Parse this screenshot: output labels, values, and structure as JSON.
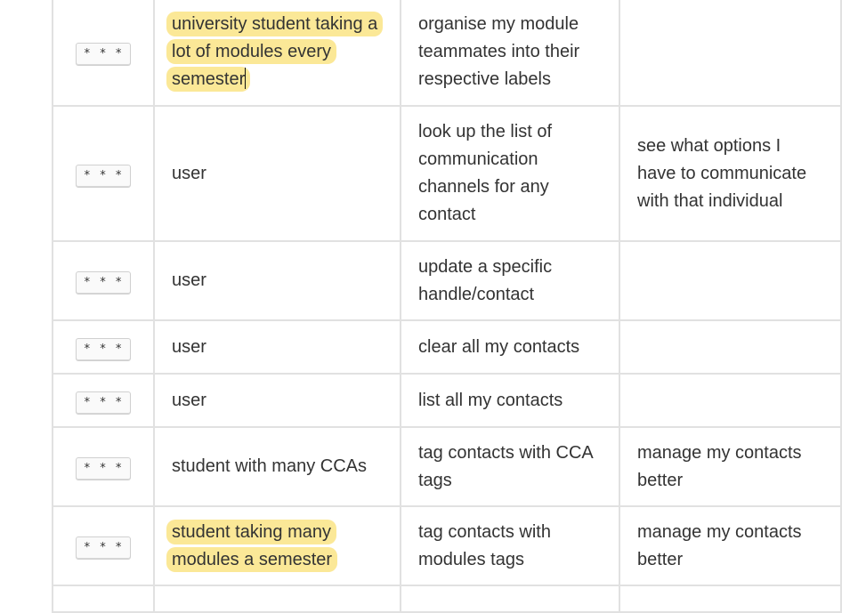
{
  "rows": [
    {
      "priority": "* * *",
      "as_a": "university student taking a lot of modules every semester",
      "as_a_highlighted": true,
      "i_want_to": "organise my module teammates into their respective labels",
      "so_that": ""
    },
    {
      "priority": "* * *",
      "as_a": "user",
      "as_a_highlighted": false,
      "i_want_to": "look up the list of communication channels for any contact",
      "so_that": "see what options I have to communicate with that individual"
    },
    {
      "priority": "* * *",
      "as_a": "user",
      "as_a_highlighted": false,
      "i_want_to": "update a specific handle/contact",
      "so_that": ""
    },
    {
      "priority": "* * *",
      "as_a": "user",
      "as_a_highlighted": false,
      "i_want_to": "clear all my contacts",
      "so_that": ""
    },
    {
      "priority": "* * *",
      "as_a": "user",
      "as_a_highlighted": false,
      "i_want_to": "list all my contacts",
      "so_that": ""
    },
    {
      "priority": "* * *",
      "as_a": "student with many CCAs",
      "as_a_highlighted": false,
      "i_want_to": "tag contacts with CCA tags",
      "so_that": "manage my contacts better"
    },
    {
      "priority": "* * *",
      "as_a": "student taking many modules a semester",
      "as_a_highlighted": true,
      "i_want_to": "tag contacts with modules tags",
      "so_that": "manage my contacts better"
    }
  ],
  "colors": {
    "highlight": "#fbe897",
    "border": "#e1e1e1",
    "text": "#333333"
  }
}
